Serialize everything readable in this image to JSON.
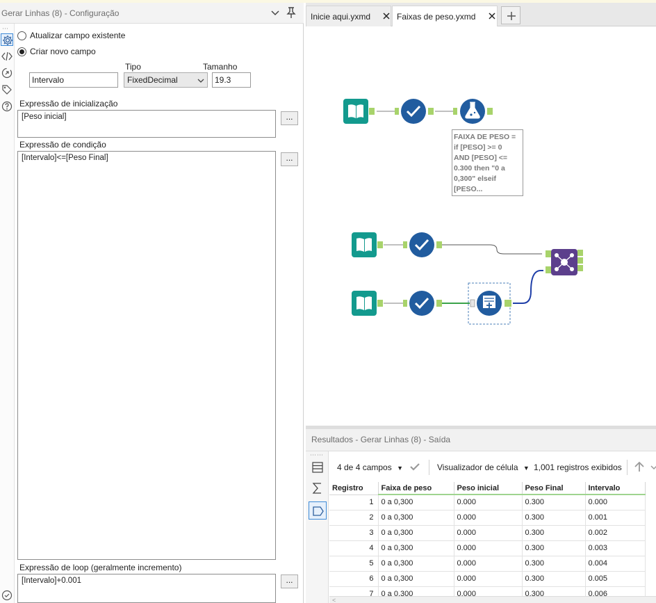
{
  "config_panel": {
    "title": "Gerar Linhas (8) - Configuração",
    "radio_update": "Atualizar campo existente",
    "radio_create": "Criar novo campo",
    "selected_radio": "create",
    "field_name_value": "Intervalo",
    "type_label": "Tipo",
    "type_value": "FixedDecimal",
    "size_label": "Tamanho",
    "size_value": "19.3",
    "init_label": "Expressão de inicialização",
    "init_value": "[Peso inicial]",
    "cond_label": "Expressão de condição",
    "cond_value": "[Intervalo]<=[Peso Final]",
    "loop_label": "Expressão de loop (geralmente incremento)",
    "loop_value": "[Intervalo]+0.001",
    "ellipsis": "...",
    "rail_icons": [
      "gear-icon",
      "code-icon",
      "navigate-icon",
      "tag-icon",
      "help-icon"
    ]
  },
  "tabs": [
    {
      "label": "Inicie aqui.yxmd",
      "active": false
    },
    {
      "label": "Faixas de peso.yxmd",
      "active": true
    }
  ],
  "canvas": {
    "annotation": "FAIXA DE PESO =\nif [PESO] >= 0\nAND [PESO] <=\n0.300 then \"0 a\n0,300\" elseif\n[PESO..."
  },
  "results": {
    "title": "Resultados - Gerar Linhas (8) - Saída",
    "fields_label": "4 de 4 campos",
    "viewer_label": "Visualizador de célula",
    "records_label": "1,001 registros exibidos",
    "columns": [
      "Registro",
      "Faixa de peso",
      "Peso inicial",
      "Peso Final",
      "Intervalo"
    ],
    "rows": [
      [
        "1",
        "0 a 0,300",
        "0.000",
        "0.300",
        "0.000"
      ],
      [
        "2",
        "0 a 0,300",
        "0.000",
        "0.300",
        "0.001"
      ],
      [
        "3",
        "0 a 0,300",
        "0.000",
        "0.300",
        "0.002"
      ],
      [
        "4",
        "0 a 0,300",
        "0.000",
        "0.300",
        "0.003"
      ],
      [
        "5",
        "0 a 0,300",
        "0.000",
        "0.300",
        "0.004"
      ],
      [
        "6",
        "0 a 0,300",
        "0.000",
        "0.300",
        "0.005"
      ],
      [
        "7",
        "0 a 0,300",
        "0.000",
        "0.300",
        "0.006"
      ]
    ]
  },
  "colors": {
    "input_tool": "#139a8e",
    "select_tool": "#215c9f",
    "formula_tool": "#215c9f",
    "join_tool": "#5c3f8c",
    "anchor": "#a8d36b",
    "connection_blue": "#1f3fa8",
    "connection_green": "#3aa34a"
  }
}
